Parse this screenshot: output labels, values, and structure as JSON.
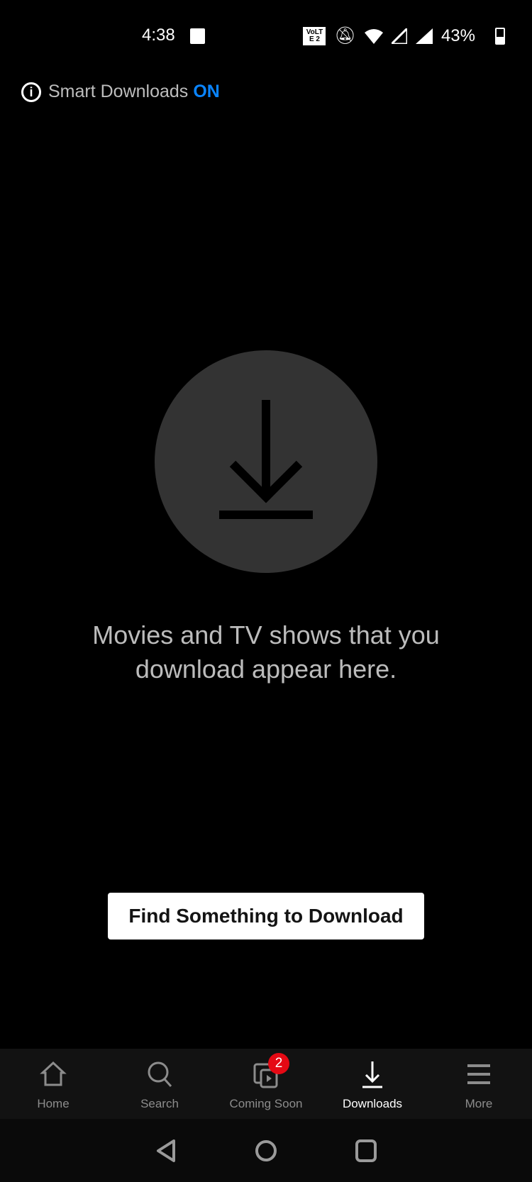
{
  "status": {
    "time": "4:38",
    "battery": "43%",
    "network": "VoLTE 2"
  },
  "smart_downloads": {
    "label": "Smart Downloads",
    "state": "ON",
    "accent": "#0a84ff"
  },
  "empty": {
    "message": "Movies and TV shows that you download appear here.",
    "button": "Find Something to Download"
  },
  "tabs": [
    {
      "label": "Home",
      "icon": "home-icon"
    },
    {
      "label": "Search",
      "icon": "search-icon"
    },
    {
      "label": "Coming Soon",
      "icon": "coming-soon-icon",
      "badge": "2"
    },
    {
      "label": "Downloads",
      "icon": "download-icon",
      "active": true
    },
    {
      "label": "More",
      "icon": "menu-icon"
    }
  ]
}
